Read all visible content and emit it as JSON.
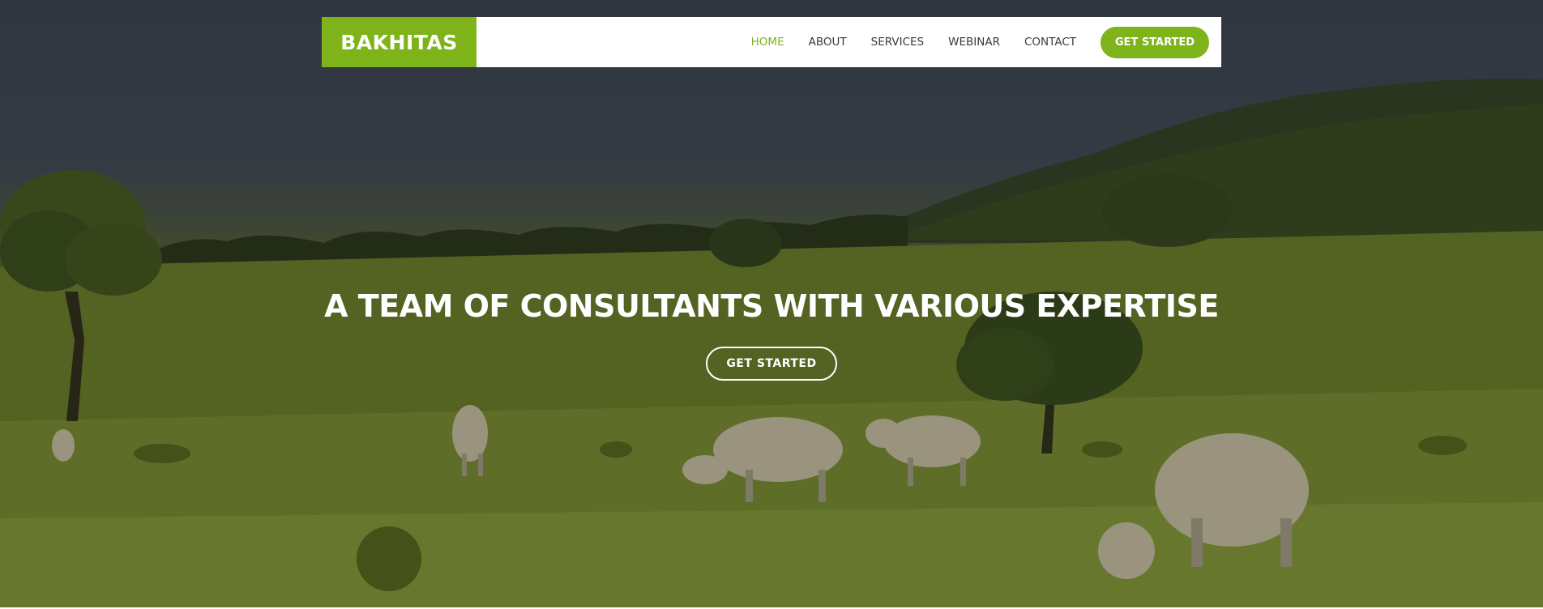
{
  "brand": {
    "logo_text": "BAKHITAS",
    "accent_color": "#7eb319"
  },
  "nav": {
    "items": [
      {
        "label": "HOME",
        "active": true
      },
      {
        "label": "ABOUT",
        "active": false
      },
      {
        "label": "SERVICES",
        "active": false
      },
      {
        "label": "WEBINAR",
        "active": false
      },
      {
        "label": "CONTACT",
        "active": false
      }
    ],
    "cta_label": "GET STARTED"
  },
  "hero": {
    "background": "pasture-with-grazing-cattle-photo",
    "title": "A TEAM OF CONSULTANTS WITH VARIOUS EXPERTISE",
    "button_label": "GET STARTED"
  }
}
